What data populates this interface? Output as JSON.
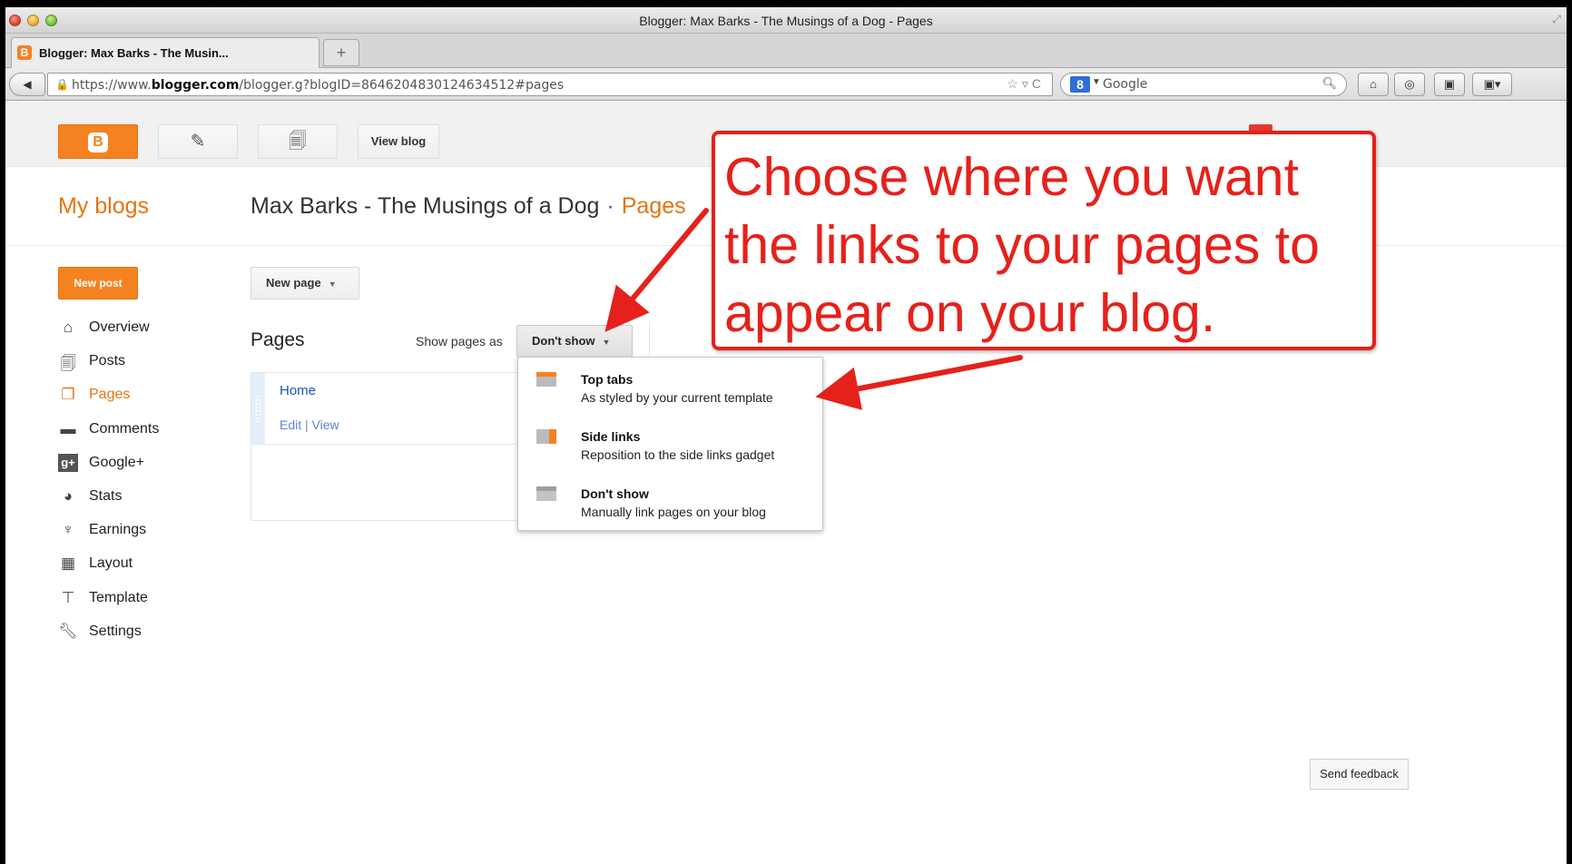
{
  "window": {
    "title": "Blogger: Max Barks - The Musings of a Dog - Pages"
  },
  "browser": {
    "tab_title": "Blogger: Max Barks - The Musin...",
    "new_tab": "+",
    "url_prefix": "https://www.",
    "url_domain": "blogger.com",
    "url_path": "/blogger.g?blogID=8646204830124634512#pages",
    "search_placeholder": "Google",
    "search_engine_label": "8"
  },
  "toolbar": {
    "view_blog": "View blog"
  },
  "header": {
    "my_blogs": "My blogs",
    "blog_title": "Max Barks - The Musings of a Dog",
    "separator": "·",
    "section": "Pages"
  },
  "sidebar": {
    "new_post": "New post",
    "items": [
      {
        "label": "Overview",
        "icon": "home-icon"
      },
      {
        "label": "Posts",
        "icon": "posts-icon"
      },
      {
        "label": "Pages",
        "icon": "pages-icon",
        "active": true
      },
      {
        "label": "Comments",
        "icon": "comments-icon"
      },
      {
        "label": "Google+",
        "icon": "google-plus-icon"
      },
      {
        "label": "Stats",
        "icon": "stats-icon"
      },
      {
        "label": "Earnings",
        "icon": "trophy-icon"
      },
      {
        "label": "Layout",
        "icon": "layout-icon"
      },
      {
        "label": "Template",
        "icon": "paint-roller-icon"
      },
      {
        "label": "Settings",
        "icon": "wrench-icon"
      }
    ]
  },
  "main": {
    "new_page": "New page",
    "pages_heading": "Pages",
    "show_pages_label": "Show pages as",
    "show_pages_value": "Don't show",
    "pages": [
      {
        "name": "Home",
        "edit": "Edit",
        "sep": "|",
        "view": "View"
      }
    ],
    "menu": [
      {
        "title": "Top tabs",
        "desc": "As styled by your current template"
      },
      {
        "title": "Side links",
        "desc": "Reposition to the side links gadget"
      },
      {
        "title": "Don't show",
        "desc": "Manually link pages on your blog"
      }
    ]
  },
  "annotation": {
    "text": "Choose where you want the links to your pages to appear on your blog."
  },
  "footer": {
    "send_feedback": "Send feedback"
  },
  "colors": {
    "accent": "#f58220",
    "annotation": "#e5211b",
    "link": "#1a55c5"
  }
}
